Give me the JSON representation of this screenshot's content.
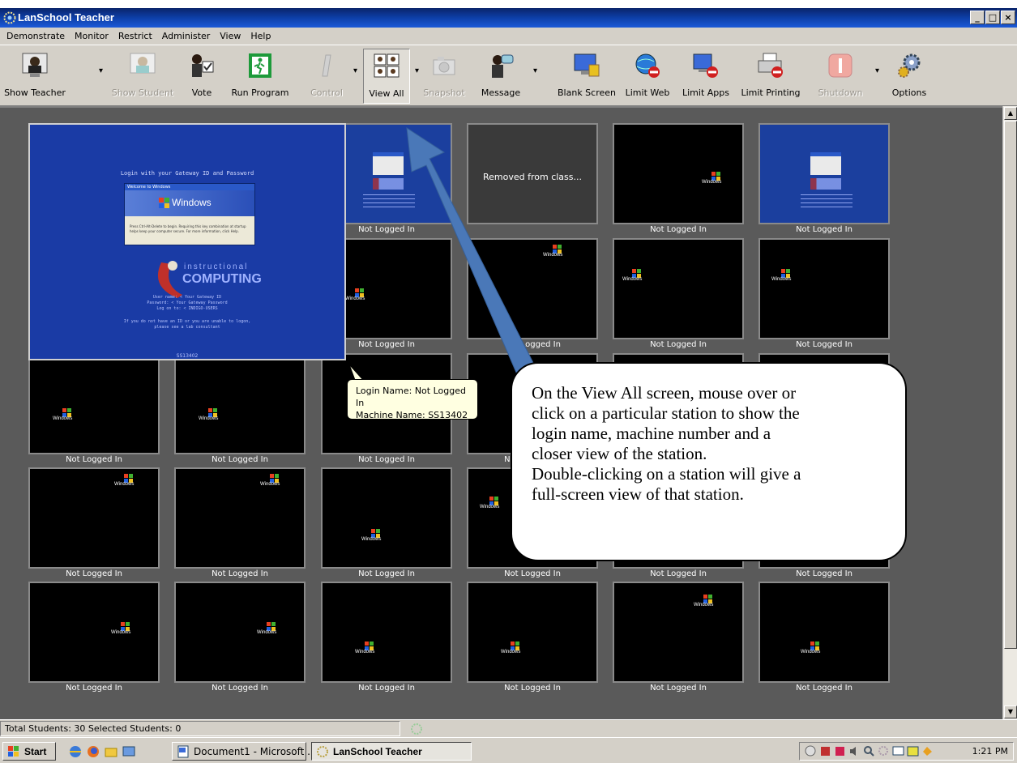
{
  "window": {
    "title": "LanSchool Teacher",
    "buttons": [
      "_",
      "□",
      "×"
    ]
  },
  "menu": [
    "Demonstrate",
    "Monitor",
    "Restrict",
    "Administer",
    "View",
    "Help"
  ],
  "toolbar": [
    {
      "label": "Show Teacher",
      "icon": "teacher-icon",
      "enabled": true
    },
    {
      "label": "Show Student",
      "icon": "student-icon",
      "enabled": false
    },
    {
      "label": "Vote",
      "icon": "vote-icon",
      "enabled": true
    },
    {
      "label": "Run Program",
      "icon": "run-program-icon",
      "enabled": true
    },
    {
      "label": "Control",
      "icon": "control-icon",
      "enabled": false
    },
    {
      "label": "View All",
      "icon": "view-all-icon",
      "enabled": true,
      "pressed": true
    },
    {
      "label": "Snapshot",
      "icon": "snapshot-icon",
      "enabled": false
    },
    {
      "label": "Message",
      "icon": "message-icon",
      "enabled": true
    },
    {
      "label": "Blank Screen",
      "icon": "blank-screen-icon",
      "enabled": true
    },
    {
      "label": "Limit Web",
      "icon": "limit-web-icon",
      "enabled": true
    },
    {
      "label": "Limit Apps",
      "icon": "limit-apps-icon",
      "enabled": true
    },
    {
      "label": "Limit Printing",
      "icon": "limit-printing-icon",
      "enabled": true
    },
    {
      "label": "Shutdown",
      "icon": "shutdown-icon",
      "enabled": false
    },
    {
      "label": "Options",
      "icon": "options-icon",
      "enabled": true
    }
  ],
  "stations": {
    "not_logged_in": "Not Logged In",
    "removed_text": "Removed from class...",
    "windows_text": "Windows",
    "edition_text": "Professional"
  },
  "preview": {
    "heading": "Login with your Gateway ID and Password",
    "dialog_title": "Welcome to Windows",
    "dialog_brand": "Windows",
    "dialog_text": "Press Ctrl-Alt-Delete to begin. Requiring this key combination at startup helps keep your computer secure. For more information, click Help.",
    "org_line1": "instructional",
    "org_line2": "COMPUTING",
    "fields": [
      "User name:  < Your Gateway ID",
      "Password:  < Your Gateway Password",
      "Log on to:  < INDIGO-USERS"
    ],
    "footer": [
      "If you do not have an ID or you are unable to logon,",
      "please see a lab consultant"
    ],
    "machine": "SS13402"
  },
  "tooltip": {
    "line1": "Login Name: Not Logged In",
    "line2": "Machine Name: SS13402"
  },
  "callout": {
    "line1": "On the View All screen, mouse over or",
    "line2": "click on a particular station to show the",
    "line3": "login name, machine number and a",
    "line4": "closer view of the station.",
    "line5": "Double-clicking on a station will give a",
    "line6": "full-screen view of that station."
  },
  "status": {
    "text": "Total Students: 30  Selected Students: 0"
  },
  "taskbar": {
    "start": "Start",
    "tasks": [
      "Document1 - Microsoft ...",
      "LanSchool Teacher"
    ],
    "clock": "1:21 PM"
  },
  "colors": {
    "title_bar": "#0d3fa8",
    "arrow": "#4a78b8",
    "workspace": "#5a5a5a",
    "tooltip_bg": "#ffffe1"
  }
}
